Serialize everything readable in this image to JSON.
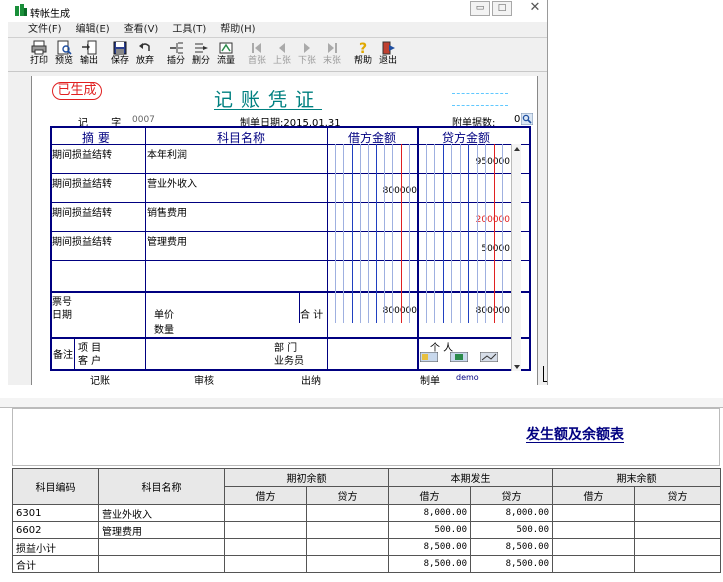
{
  "window": {
    "title": "转帐生成",
    "controls": {
      "min": "▭",
      "max": "□",
      "close": "✕"
    }
  },
  "menu": [
    "文件(F)",
    "编辑(E)",
    "查看(V)",
    "工具(T)",
    "帮助(H)"
  ],
  "toolbar": [
    {
      "label": "打印",
      "icon": "printer-icon",
      "enabled": true
    },
    {
      "label": "预览",
      "icon": "preview-icon",
      "enabled": true
    },
    {
      "label": "输出",
      "icon": "export-icon",
      "enabled": true
    },
    {
      "label": "保存",
      "icon": "save-icon",
      "enabled": true
    },
    {
      "label": "放弃",
      "icon": "undo-icon",
      "enabled": true
    },
    {
      "label": "插分",
      "icon": "insert-row-icon",
      "enabled": true
    },
    {
      "label": "删分",
      "icon": "delete-row-icon",
      "enabled": true
    },
    {
      "label": "流量",
      "icon": "flow-icon",
      "enabled": true
    },
    {
      "label": "首张",
      "icon": "first-icon",
      "enabled": false
    },
    {
      "label": "上张",
      "icon": "prev-icon",
      "enabled": false
    },
    {
      "label": "下张",
      "icon": "next-icon",
      "enabled": false
    },
    {
      "label": "末张",
      "icon": "last-icon",
      "enabled": false
    },
    {
      "label": "帮助",
      "icon": "help-icon",
      "enabled": true
    },
    {
      "label": "退出",
      "icon": "exit-icon",
      "enabled": true
    }
  ],
  "voucher": {
    "stamp": "已生成",
    "title": "记账凭证",
    "type_label": "记 字",
    "number": "0007",
    "date_label": "制单日期:",
    "date": "2015.01.31",
    "attach_label": "附单据数:",
    "attach_count": "0",
    "headers": {
      "summary": "摘 要",
      "account": "科目名称",
      "debit": "借方金额",
      "credit": "贷方金额"
    },
    "rows": [
      {
        "summary": "期间损益结转",
        "account": "本年利润",
        "debit": "",
        "credit": "950000",
        "red": false
      },
      {
        "summary": "期间损益结转",
        "account": "营业外收入",
        "debit": "800000",
        "credit": "",
        "red": false
      },
      {
        "summary": "期间损益结转",
        "account": "销售费用",
        "debit": "",
        "credit": "200000",
        "red": true
      },
      {
        "summary": "期间损益结转",
        "account": "管理费用",
        "debit": "",
        "credit": "50000",
        "red": false
      }
    ],
    "footer": {
      "ticket": "票号",
      "date": "日期",
      "price": "单价",
      "qty": "数量",
      "total_label": "合 计",
      "total_debit": "800000",
      "total_credit": "800000",
      "remark": "备注",
      "project": "项 目",
      "customer": "客 户",
      "dept": "部 门",
      "salesman": "业务员",
      "person": "个 人"
    },
    "signatures": {
      "post": "记账",
      "audit": "审核",
      "cashier": "出纳",
      "maker": "制单",
      "maker_name": "demo"
    }
  },
  "report": {
    "title": "发生额及余额表",
    "headers": {
      "code": "科目编码",
      "name": "科目名称",
      "opening": "期初余额",
      "period": "本期发生",
      "closing": "期末余额",
      "debit": "借方",
      "credit": "贷方"
    },
    "rows": [
      {
        "code": "6301",
        "name": "营业外收入",
        "debit": "8,000.00",
        "credit": "8,000.00"
      },
      {
        "code": "6602",
        "name": "管理费用",
        "debit": "500.00",
        "credit": "500.00"
      },
      {
        "code": "损益小计",
        "name": "",
        "debit": "8,500.00",
        "credit": "8,500.00"
      },
      {
        "code": "合计",
        "name": "",
        "debit": "8,500.00",
        "credit": "8,500.00"
      }
    ]
  }
}
